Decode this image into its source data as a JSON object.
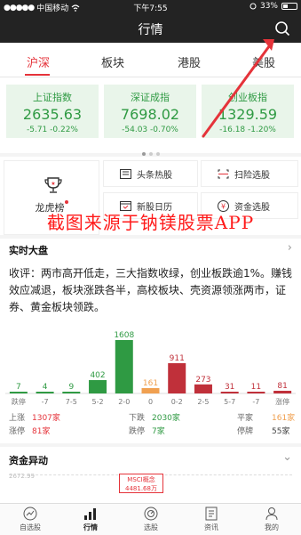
{
  "status_bar": {
    "carrier": "中国移动",
    "time": "下午7:55",
    "battery": "33%"
  },
  "nav": {
    "title": "行情"
  },
  "tabs": [
    "沪深",
    "板块",
    "港股",
    "美股"
  ],
  "indices": [
    {
      "name": "上证指数",
      "value": "2635.63",
      "change": "-5.71  -0.22%"
    },
    {
      "name": "深证成指",
      "value": "7698.02",
      "change": "-54.03  -0.70%"
    },
    {
      "name": "创业板指",
      "value": "1329.59",
      "change": "-16.18  -1.20%"
    }
  ],
  "features": {
    "dragon": "龙虎榜",
    "items": [
      "头条热股",
      "扫险选股",
      "新股日历",
      "资金选股"
    ]
  },
  "watermark": "截图来源于钠镁股票APP",
  "market": {
    "title": "实时大盘",
    "commentary": "收评：两市高开低走，三大指数收绿，创业板跌逾1%。赚钱效应减退，板块涨跌各半，高校板块、壳资源领涨两市，证券、黄金板块领跌。"
  },
  "chart_data": {
    "type": "bar",
    "categories": [
      "跌停",
      "-7",
      "7-5",
      "5-2",
      "2-0",
      "0",
      "0-2",
      "2-5",
      "5-7",
      "-7",
      "涨停"
    ],
    "values": [
      7,
      4,
      9,
      402,
      1608,
      161,
      911,
      273,
      31,
      11,
      81
    ],
    "colors": [
      "#2f9a43",
      "#2f9a43",
      "#2f9a43",
      "#2f9a43",
      "#2f9a43",
      "#f0a050",
      "#c0303a",
      "#c0303a",
      "#c0303a",
      "#c0303a",
      "#c0303a"
    ]
  },
  "stats": {
    "up_label": "上涨",
    "up_value": "1307家",
    "down_label": "下跌",
    "down_value": "2030家",
    "flat_label": "平家",
    "flat_value": "161家",
    "limit_up_label": "涨停",
    "limit_up_value": "81家",
    "limit_down_label": "跌停",
    "limit_down_value": "7家",
    "suspend_label": "停牌",
    "suspend_value": "55家"
  },
  "fund": {
    "title": "资金异动",
    "axis_value": "2672.99",
    "tag_line1": "MSCI概念",
    "tag_line2": "4481.68万"
  },
  "bottom_nav": [
    "自选股",
    "行情",
    "选股",
    "资讯",
    "我的"
  ],
  "colors": {
    "red": "#e5333a",
    "green": "#2f9a43",
    "dark": "#232323"
  }
}
